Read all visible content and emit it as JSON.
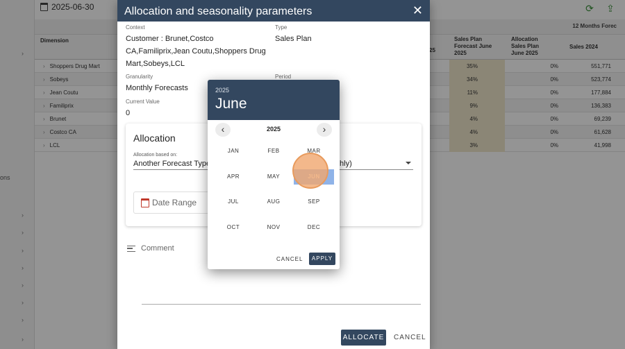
{
  "background": {
    "side_fragment": "ons",
    "top_date": "2025-06-30",
    "header_band_label": "12 Months Forec",
    "columns": {
      "dimension": "Dimension",
      "pct": "25",
      "sales_plan_forecast": "Sales Plan Forecast June 2025",
      "allocation_sales_plan": "Allocation Sales Plan June 2025",
      "sales_2024": "Sales 2024"
    },
    "rows": [
      {
        "dimension": "Shoppers Drug Mart",
        "pct": "35%",
        "alloc": "0%",
        "sales": "551,771"
      },
      {
        "dimension": "Sobeys",
        "pct": "34%",
        "alloc": "0%",
        "sales": "523,774"
      },
      {
        "dimension": "Jean Coutu",
        "pct": "11%",
        "alloc": "0%",
        "sales": "177,884"
      },
      {
        "dimension": "Familiprix",
        "pct": "9%",
        "alloc": "0%",
        "sales": "136,383"
      },
      {
        "dimension": "Brunet",
        "pct": "4%",
        "alloc": "0%",
        "sales": "69,239"
      },
      {
        "dimension": "Costco CA",
        "pct": "4%",
        "alloc": "0%",
        "sales": "61,628"
      },
      {
        "dimension": "LCL",
        "pct": "3%",
        "alloc": "0%",
        "sales": "41,998"
      }
    ]
  },
  "dialog": {
    "title": "Allocation and seasonality parameters",
    "context_label": "Context",
    "context_lines": [
      "Customer : Brunet,Costco",
      "CA,Familiprix,Jean Coutu,Shoppers Drug",
      "Mart,Sobeys,LCL"
    ],
    "type_label": "Type",
    "type_value": "Sales Plan",
    "granularity_label": "Granularity",
    "granularity_value": "Monthly Forecasts",
    "period_label": "Period",
    "current_value_label": "Current Value",
    "current_value": "0",
    "allocation_title": "Allocation",
    "allocation_based_on_label": "Allocation based on:",
    "allocation_based_on_value": "Another Forecast Type",
    "allocation_right_fragment": "thly)",
    "date_range_label": "Date Range",
    "comment_label": "Comment",
    "allocate_button": "ALLOCATE",
    "cancel_button": "CANCEL"
  },
  "picker": {
    "header_year": "2025",
    "header_month": "June",
    "nav_year": "2025",
    "prev_icon": "‹",
    "next_icon": "›",
    "months": [
      "JAN",
      "FEB",
      "MAR",
      "APR",
      "MAY",
      "JUN",
      "JUL",
      "AUG",
      "SEP",
      "OCT",
      "NOV",
      "DEC"
    ],
    "selected_month": "JUN",
    "cancel_label": "CANCEL",
    "apply_label": "APPLY"
  },
  "colors": {
    "primary": "#33475f",
    "selected_month_bg": "#8fb3e8",
    "ripple": "#f0a66e",
    "cell_tan": "#efe7cc",
    "date_icon": "#c0392b"
  }
}
